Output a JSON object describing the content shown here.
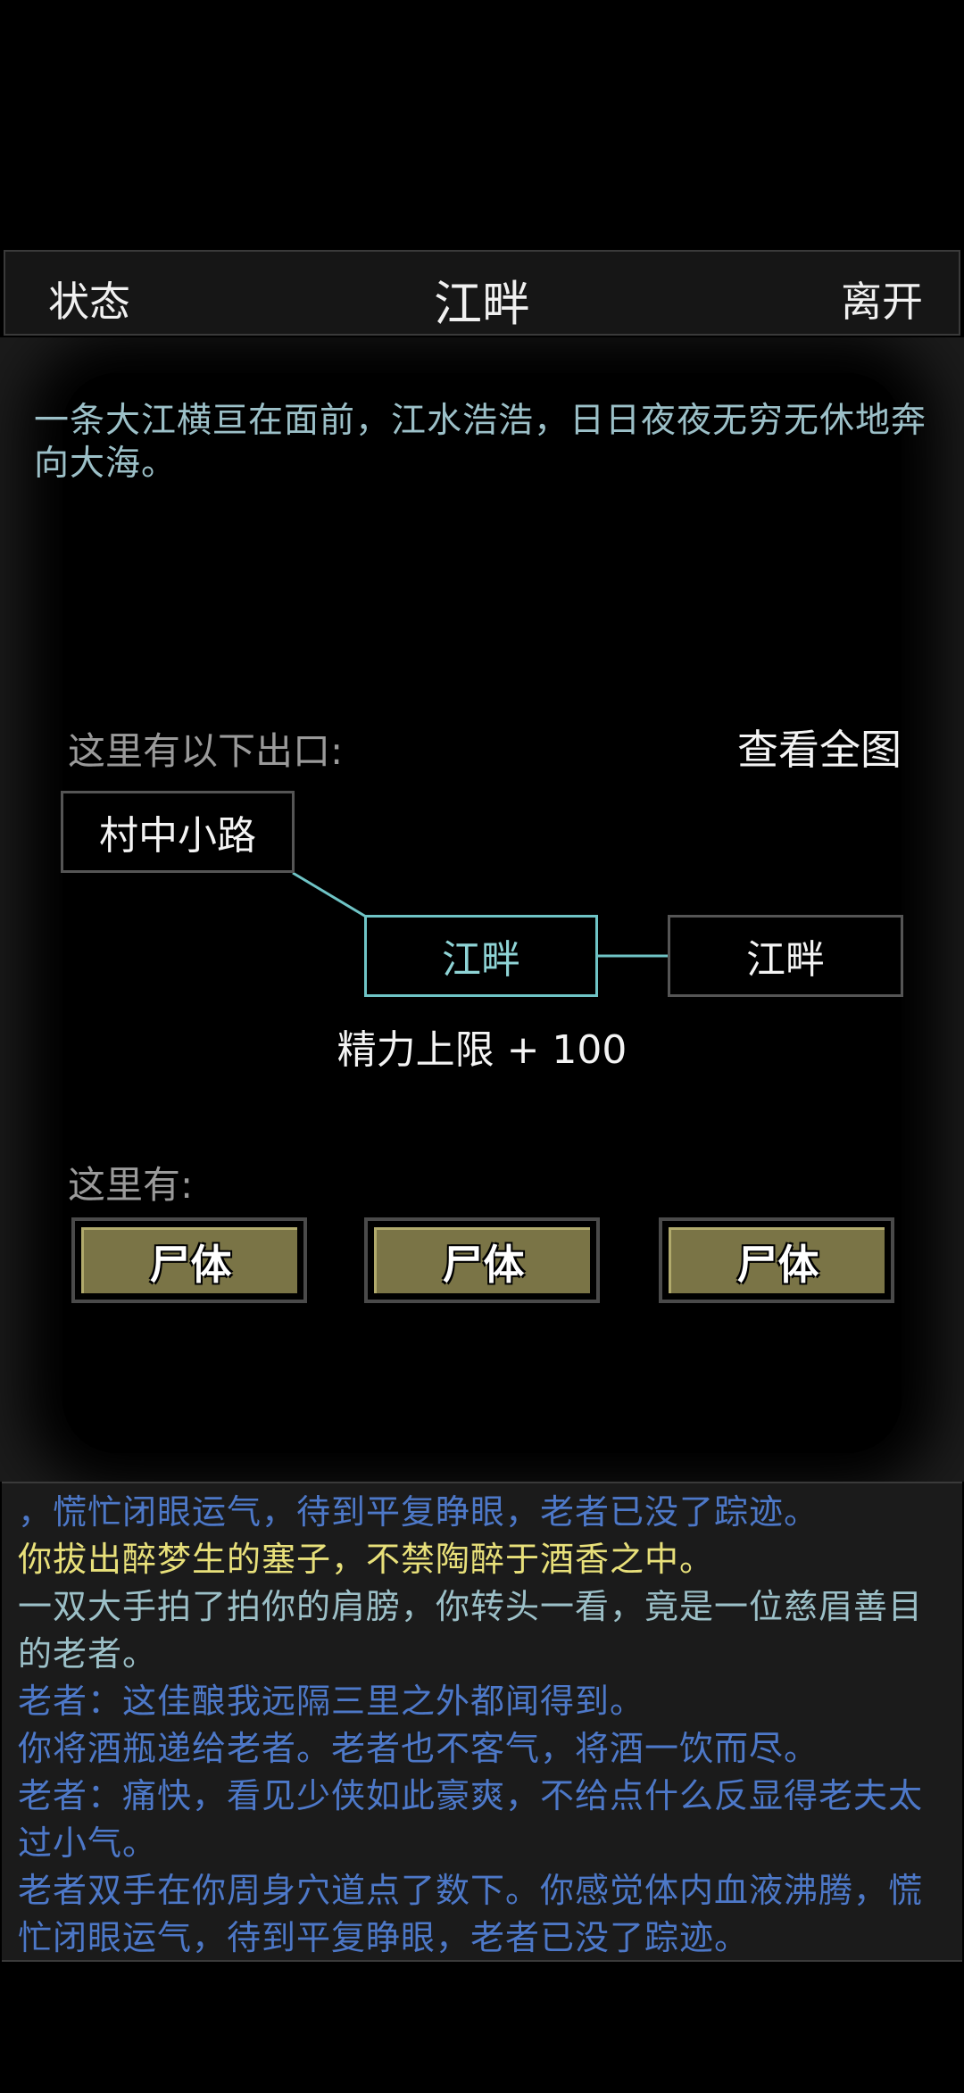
{
  "header": {
    "status_label": "状态",
    "title": "江畔",
    "leave_label": "离开"
  },
  "description": "一条大江横亘在面前，江水浩浩，日日夜夜无穷无休地奔向大海。",
  "exits": {
    "label": "这里有以下出口:",
    "view_map_label": "查看全图",
    "nodes": [
      {
        "label": "村中小路",
        "current": false
      },
      {
        "label": "江畔",
        "current": true
      },
      {
        "label": "江畔",
        "current": false
      }
    ],
    "bonus_text": "精力上限 + 100"
  },
  "here": {
    "label": "这里有:",
    "items": [
      {
        "label": "尸体"
      },
      {
        "label": "尸体"
      },
      {
        "label": "尸体"
      }
    ]
  },
  "log": [
    {
      "text": "，慌忙闭眼运气，待到平复睁眼，老者已没了踪迹。",
      "color": "#4d78c8"
    },
    {
      "text": "你拔出醉梦生的塞子，不禁陶醉于酒香之中。",
      "color": "#e8e07a"
    },
    {
      "text": "一双大手拍了拍你的肩膀，你转头一看，竟是一位慈眉善目的老者。",
      "color": "#9cc0c8"
    },
    {
      "text": "老者：这佳酿我远隔三里之外都闻得到。",
      "color": "#4d78c8"
    },
    {
      "text": "你将酒瓶递给老者。老者也不客气，将酒一饮而尽。",
      "color": "#4d78c8"
    },
    {
      "text": "老者：痛快，看见少侠如此豪爽，不给点什么反显得老夫太过小气。",
      "color": "#4d78c8"
    },
    {
      "text": "老者双手在你周身穴道点了数下。你感觉体内血液沸腾，慌忙闭眼运气，待到平复睁眼，老者已没了踪迹。",
      "color": "#4d78c8"
    }
  ],
  "colors": {
    "accent_current_node": "#6fc4c6",
    "item_button": "#7a7446",
    "log_blue": "#4d78c8",
    "log_yellow": "#e8e07a",
    "log_cyan": "#9cc0c8"
  }
}
